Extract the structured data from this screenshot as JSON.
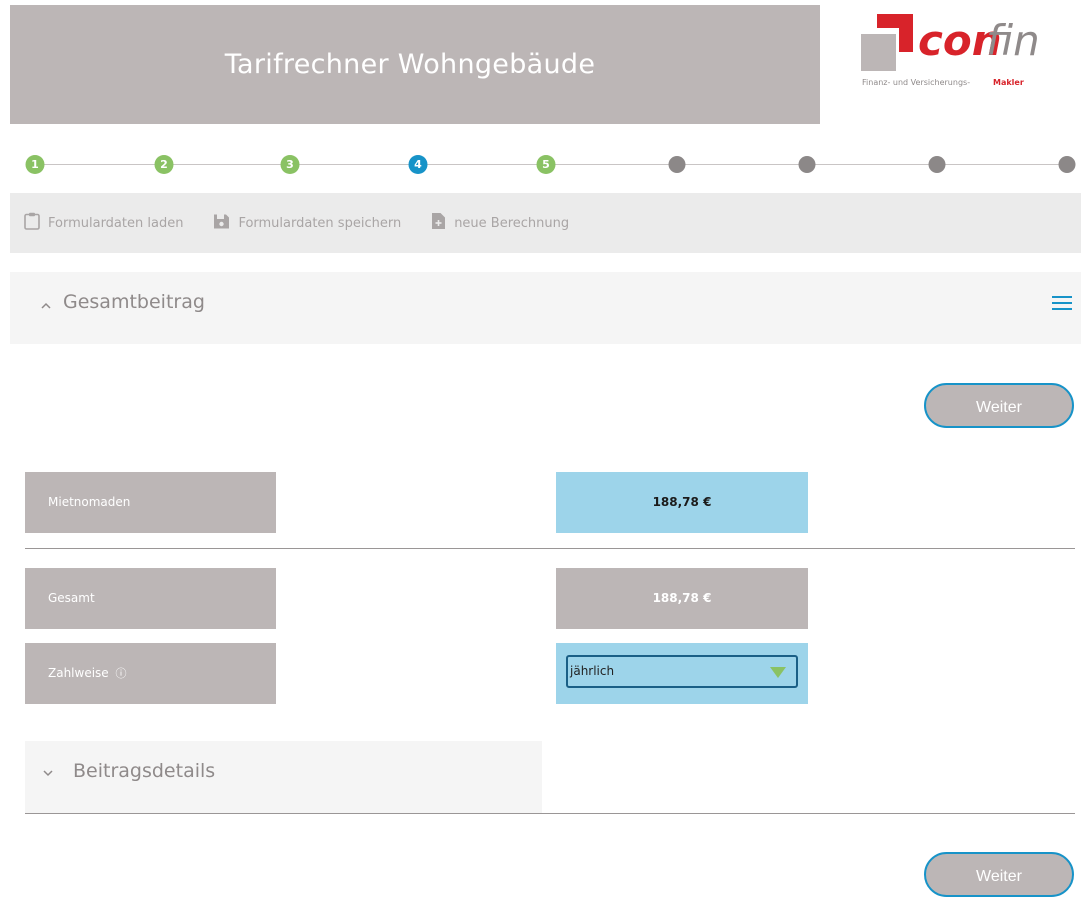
{
  "header": {
    "title": "Tarifrechner Wohngebäude"
  },
  "logo": {
    "word_con": "con",
    "word_fin": "fin",
    "tagline": "Finanz- und Versicherungs-",
    "makler": "Makler"
  },
  "stepper": {
    "steps": [
      {
        "label": "1",
        "state": "done"
      },
      {
        "label": "2",
        "state": "done"
      },
      {
        "label": "3",
        "state": "done"
      },
      {
        "label": "4",
        "state": "active"
      },
      {
        "label": "5",
        "state": "done"
      },
      {
        "label": "",
        "state": "todo"
      },
      {
        "label": "",
        "state": "todo"
      },
      {
        "label": "",
        "state": "todo"
      },
      {
        "label": "",
        "state": "todo"
      }
    ]
  },
  "toolbar": {
    "load_label": "Formulardaten laden",
    "save_label": "Formulardaten speichern",
    "new_label": "neue Berechnung"
  },
  "gesamtbeitrag": {
    "title": "Gesamtbeitrag"
  },
  "actions": {
    "weiter_top": "Weiter",
    "weiter_bottom": "Weiter"
  },
  "rows": {
    "mietnomaden": {
      "label": "Mietnomaden",
      "value": "188,78 €"
    },
    "gesamt": {
      "label": "Gesamt",
      "value": "188,78 €"
    },
    "zahlweise": {
      "label": "Zahlweise",
      "info_glyph": "ⓘ",
      "selected": "jährlich"
    }
  },
  "beitragsdetails": {
    "title": "Beitragsdetails"
  },
  "colors": {
    "accent": "#1793c8",
    "done": "#8ac264",
    "brand_red": "#d8232a",
    "grey": "#bcb6b6",
    "value_blue": "#9dd4ea"
  }
}
